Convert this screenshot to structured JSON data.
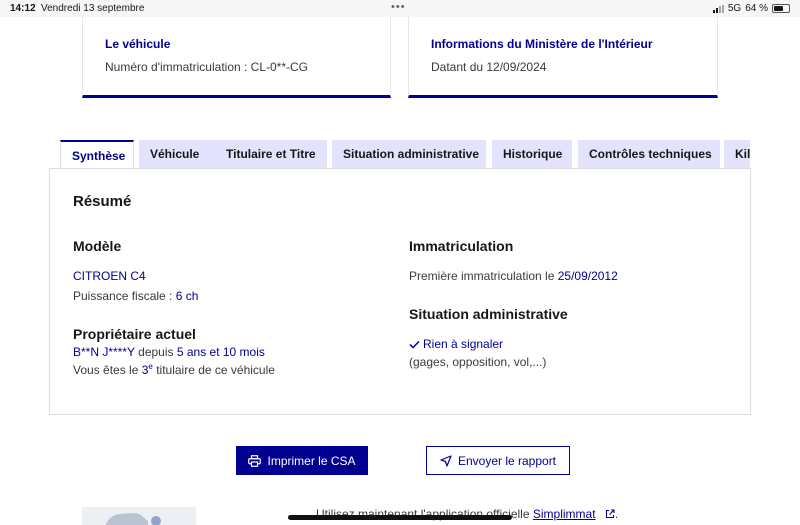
{
  "status_bar": {
    "time": "14:12",
    "date": "Vendredi 13 septembre",
    "network": "5G",
    "battery": "64 %"
  },
  "cards": {
    "vehicle": {
      "title": "Le véhicule",
      "text": "Numéro d'immatriculation : CL-0**-CG"
    },
    "ministry": {
      "title": "Informations du Ministère de l'Intérieur",
      "text": "Datant du 12/09/2024"
    }
  },
  "tabs": [
    {
      "label": "Synthèse"
    },
    {
      "label": "Véhicule"
    },
    {
      "label": "Titulaire et Titre"
    },
    {
      "label": "Situation administrative"
    },
    {
      "label": "Historique"
    },
    {
      "label": "Contrôles techniques"
    },
    {
      "label": "Kilo"
    }
  ],
  "summary": {
    "heading": "Résumé",
    "model": {
      "heading": "Modèle",
      "name": "CITROEN C4",
      "fiscal_label": "Puissance fiscale : ",
      "fiscal_value": "6 ch"
    },
    "owner": {
      "heading": "Propriétaire actuel",
      "name": "B**N J****Y",
      "since_label": " depuis ",
      "since_value": "5 ans et 10 mois",
      "rank_prefix": "Vous êtes le ",
      "rank_number": "3",
      "rank_sup": "e",
      "rank_suffix": " titulaire de ce véhicule"
    },
    "registration": {
      "heading": "Immatriculation",
      "label": "Première immatriculation le ",
      "date": "25/09/2012"
    },
    "admin": {
      "heading": "Situation administrative",
      "status": "Rien à signaler",
      "details": "(gages, opposition, vol,...)"
    }
  },
  "actions": {
    "print_label": "Imprimer le CSA",
    "send_label": "Envoyer le rapport"
  },
  "footer": {
    "text": "Utilisez maintenant l'application officielle ",
    "link": "Simplimmat",
    "end": "."
  },
  "colors": {
    "primary": "#000091",
    "tab_bg": "#e3e3fd"
  }
}
